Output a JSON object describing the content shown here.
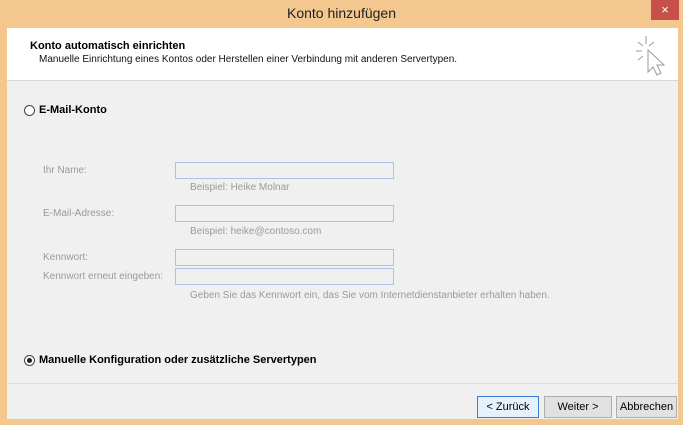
{
  "window": {
    "title": "Konto hinzufügen",
    "close_glyph": "×"
  },
  "header": {
    "title": "Konto automatisch einrichten",
    "subtitle": "Manuelle Einrichtung eines Kontos oder Herstellen einer Verbindung mit anderen Servertypen."
  },
  "options": {
    "email_account": {
      "label": "E-Mail-Konto",
      "checked": false
    },
    "manual_config": {
      "label": "Manuelle Konfiguration oder zusätzliche Servertypen",
      "checked": true
    }
  },
  "form": {
    "name": {
      "label": "Ihr Name:",
      "value": "",
      "hint": "Beispiel: Heike Molnar"
    },
    "email": {
      "label": "E-Mail-Adresse:",
      "value": "",
      "hint": "Beispiel: heike@contoso.com"
    },
    "password": {
      "label": "Kennwort:",
      "value": ""
    },
    "password_confirm": {
      "label": "Kennwort erneut eingeben:",
      "value": ""
    },
    "password_hint": "Geben Sie das Kennwort ein, das Sie vom Internetdienstanbieter erhalten haben."
  },
  "buttons": {
    "back": "< Zurück",
    "next": "Weiter >",
    "cancel": "Abbrechen"
  },
  "icons": {
    "wizard": "cursor-sparkle-icon"
  },
  "colors": {
    "titlebar": "#f3c78e",
    "close": "#c7504b",
    "field_border": "#a9c2e6",
    "primary_border": "#3a7bd5"
  }
}
